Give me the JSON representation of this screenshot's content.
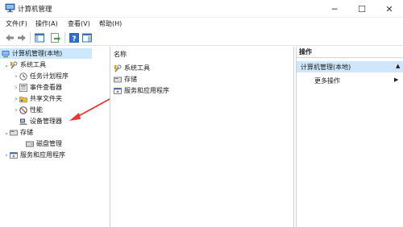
{
  "window": {
    "title": "计算机管理",
    "min_glyph": "─",
    "max_glyph": "☐",
    "close_glyph": "✕"
  },
  "menu": {
    "items": [
      "文件(F)",
      "操作(A)",
      "查看(V)",
      "帮助(H)"
    ]
  },
  "toolbar": {
    "icons": [
      "back-arrow-icon",
      "forward-arrow-icon",
      "show-hide-tree-icon",
      "export-list-icon",
      "help-icon",
      "console-tree-icon"
    ]
  },
  "tree": {
    "root": "计算机管理(本地)",
    "system_tools": "系统工具",
    "task_scheduler": "任务计划程序",
    "event_viewer": "事件查看器",
    "shared_folders": "共享文件夹",
    "performance": "性能",
    "device_manager": "设备管理器",
    "storage": "存储",
    "disk_management": "磁盘管理",
    "services_apps": "服务和应用程序"
  },
  "list": {
    "header": "名称",
    "items": [
      "系统工具",
      "存储",
      "服务和应用程序"
    ]
  },
  "actions": {
    "header": "操作",
    "group": "计算机管理(本地)",
    "more": "更多操作",
    "arrow_glyph": "▲",
    "more_arrow_glyph": "▶"
  },
  "colors": {
    "selection": "#cce8ff",
    "action_group": "#cfe6fb",
    "annotation_arrow": "#e53935"
  }
}
